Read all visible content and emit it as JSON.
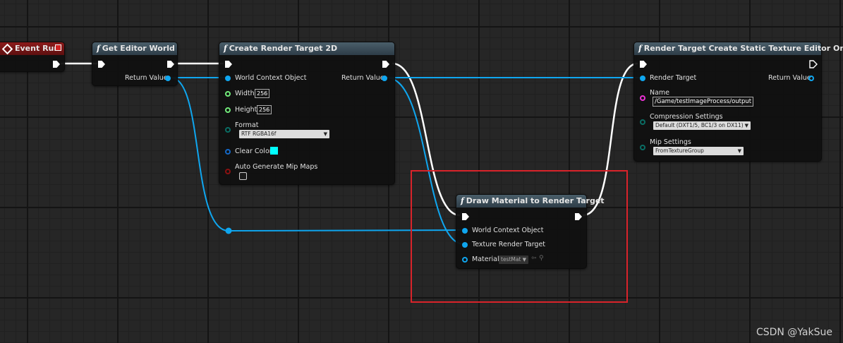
{
  "colors": {
    "canvas_bg": "#262626",
    "exec_wire": "#ffffff",
    "object_wire": "#0fa6ef",
    "function_header": "#4a5e6a",
    "event_header": "#8c1b1b",
    "highlight": "#d9232a"
  },
  "nodes": {
    "event_run": {
      "title": "Event Run",
      "icon": "event-diamond-icon"
    },
    "get_editor_world": {
      "title": "Get Editor World",
      "icon": "function-icon",
      "return_label": "Return Value"
    },
    "create_render_target": {
      "title": "Create Render Target 2D",
      "icon": "function-icon",
      "world_context_label": "World Context Object",
      "width_label": "Width",
      "width_value": "256",
      "height_label": "Height",
      "height_value": "256",
      "format_label": "Format",
      "format_value": "RTF RGBA16f",
      "clear_color_label": "Clear Color",
      "auto_mip_label": "Auto Generate Mip Maps",
      "auto_mip_checked": false,
      "return_label": "Return Value"
    },
    "draw_material": {
      "title": "Draw Material to Render Target",
      "icon": "function-icon",
      "world_context_label": "World Context Object",
      "texture_rt_label": "Texture Render Target",
      "material_label": "Material",
      "material_value": "testMat"
    },
    "static_texture": {
      "title": "Render Target Create Static Texture Editor Only",
      "icon": "function-icon",
      "render_target_label": "Render Target",
      "return_label": "Return Value",
      "name_label": "Name",
      "name_value": "/Game/testImageProcess/output",
      "compression_label": "Compression Settings",
      "compression_value": "Default (DXT1/5, BC1/3 on DX11)",
      "mip_label": "Mip Settings",
      "mip_value": "FromTextureGroup"
    }
  },
  "watermark": "CSDN @YakSue"
}
